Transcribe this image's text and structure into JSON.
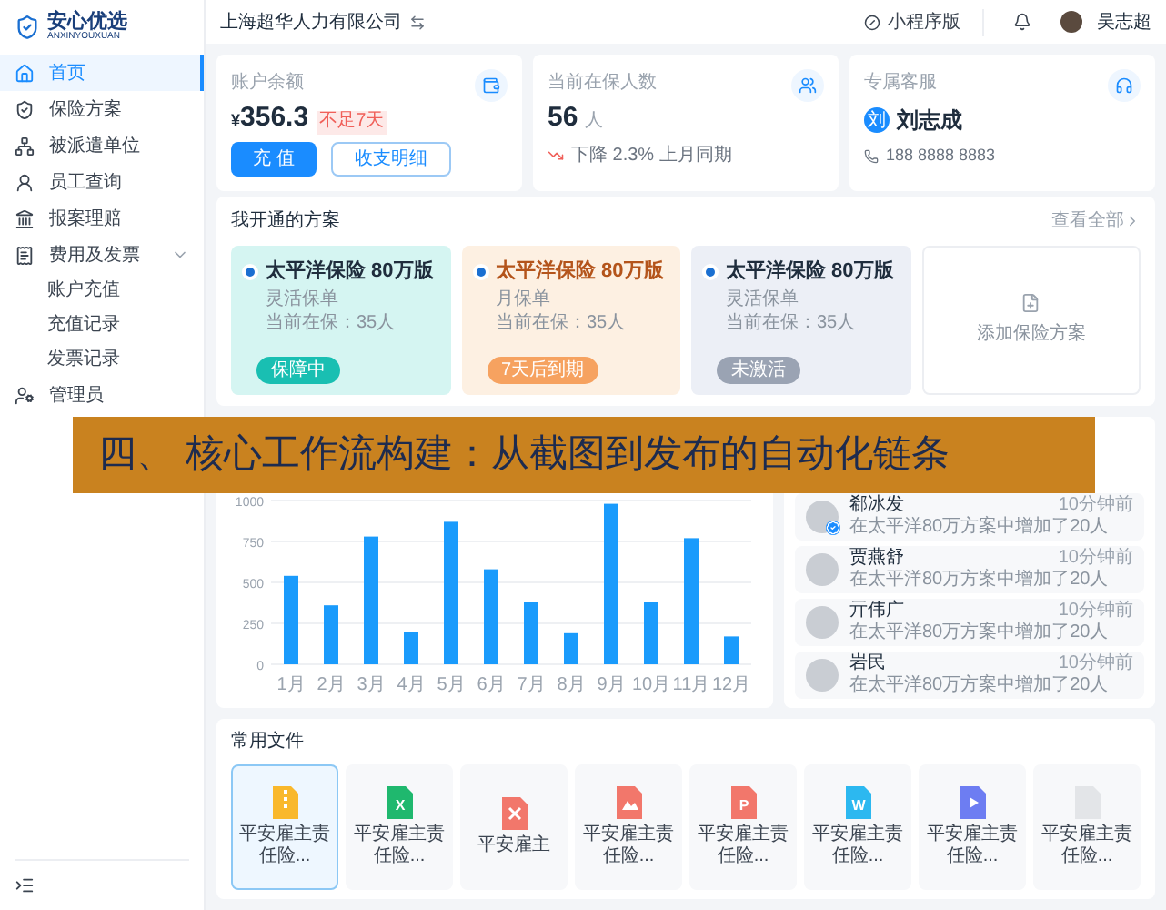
{
  "sidebar": {
    "logo": {
      "name": "安心优选",
      "subtitle": "ANXINYOUXUAN"
    },
    "items": [
      {
        "label": "首页",
        "selected": true
      },
      {
        "label": "保险方案",
        "selected": false
      },
      {
        "label": "被派遣单位",
        "selected": false
      },
      {
        "label": "员工查询",
        "selected": false
      },
      {
        "label": "报案理赔",
        "selected": false
      },
      {
        "label": "费用及发票",
        "selected": false,
        "expanded": true,
        "children": [
          {
            "label": "账户充值",
            "selected": false
          },
          {
            "label": "充值记录",
            "selected": false
          },
          {
            "label": "发票记录",
            "selected": false
          }
        ]
      },
      {
        "label": "管理员",
        "selected": false
      }
    ]
  },
  "header": {
    "company": "上海超华人力有限公司",
    "mini_program": "小程序版",
    "user": "吴志超"
  },
  "stats": {
    "balance": {
      "label": "账户余额",
      "currency": "¥",
      "value": "356.3",
      "tag": "不足7天",
      "buttons": [
        "充 值",
        "收支明细"
      ]
    },
    "insured": {
      "label": "当前在保人数",
      "value": "56",
      "unit": "人",
      "trend": "下降 2.3% 上月同期"
    },
    "service": {
      "label": "专属客服",
      "initial": "刘",
      "name": "刘志成",
      "phone": "188 8888 8883"
    }
  },
  "plans": {
    "title": "我开通的方案",
    "view_all": "查看全部",
    "add_label": "添加保险方案",
    "items": [
      {
        "name": "太平洋保险 80万版",
        "type": "灵活保单",
        "count": "当前在保：35人",
        "status": "保障中",
        "kind": "active"
      },
      {
        "name": "太平洋保险 80万版",
        "type": "月保单",
        "count": "当前在保：35人",
        "status": "7天后到期",
        "kind": "expiring"
      },
      {
        "name": "太平洋保险 80万版",
        "type": "灵活保单",
        "count": "当前在保：35人",
        "status": "未激活",
        "kind": "inactive"
      }
    ]
  },
  "banner": "四、 核心工作流构建：从截图到发布的自动化链条",
  "chart_data": {
    "type": "bar",
    "categories": [
      "1月",
      "2月",
      "3月",
      "4月",
      "5月",
      "6月",
      "7月",
      "8月",
      "9月",
      "10月",
      "11月",
      "12月"
    ],
    "grid": true,
    "series": [
      {
        "color": "#1a9bfc",
        "values": [
          540,
          360,
          780,
          200,
          870,
          580,
          380,
          190,
          980,
          380,
          770,
          170
        ]
      }
    ],
    "ylim": [
      0,
      1000
    ],
    "yticks": [
      0,
      250,
      500,
      750,
      1000
    ]
  },
  "activities": [
    {
      "name": "郗冰发",
      "time": "10分钟前",
      "text": "在太平洋80万方案中增加了20人",
      "verified": true
    },
    {
      "name": "贾燕舒",
      "time": "10分钟前",
      "text": "在太平洋80万方案中增加了20人",
      "verified": false
    },
    {
      "name": "亓伟广",
      "time": "10分钟前",
      "text": "在太平洋80万方案中增加了20人",
      "verified": false
    },
    {
      "name": "岩民",
      "time": "10分钟前",
      "text": "在太平洋80万方案中增加了20人",
      "verified": false
    }
  ],
  "files": {
    "title": "常用文件",
    "items": [
      {
        "name": "平安雇主责任险...",
        "kind": "zip",
        "selected": true
      },
      {
        "name": "平安雇主责任险...",
        "kind": "excel",
        "letter": "X",
        "selected": false
      },
      {
        "name": "平安雇主",
        "kind": "pdf",
        "selected": false
      },
      {
        "name": "平安雇主责任险...",
        "kind": "image",
        "selected": false
      },
      {
        "name": "平安雇主责任险...",
        "kind": "ppt",
        "letter": "P",
        "selected": false
      },
      {
        "name": "平安雇主责任险...",
        "kind": "word",
        "letter": "W",
        "selected": false
      },
      {
        "name": "平安雇主责任险...",
        "kind": "video",
        "selected": false
      },
      {
        "name": "平安雇主责任险...",
        "kind": "blank",
        "selected": false
      }
    ]
  }
}
